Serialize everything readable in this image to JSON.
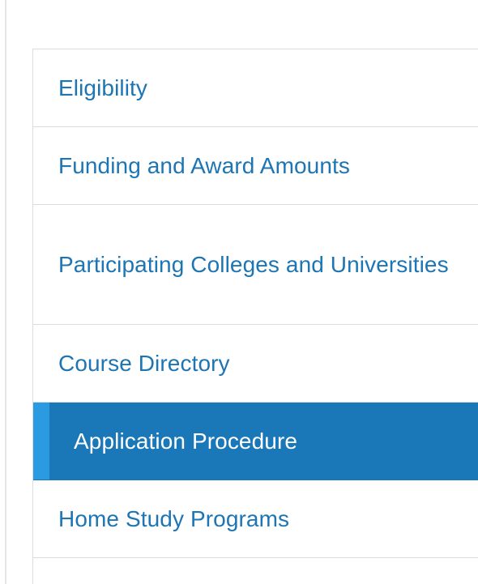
{
  "nav": {
    "items": [
      {
        "label": "Eligibility"
      },
      {
        "label": "Funding and Award Amounts"
      },
      {
        "label": "Participating Colleges and Universities"
      },
      {
        "label": "Course Directory"
      },
      {
        "label": "Application Procedure",
        "active": true
      },
      {
        "label": "Home Study Programs"
      }
    ]
  },
  "colors": {
    "link": "#1d75b3",
    "active_background": "#1a77b8",
    "active_marker": "#2a9be0",
    "divider": "#dcdcdc"
  }
}
